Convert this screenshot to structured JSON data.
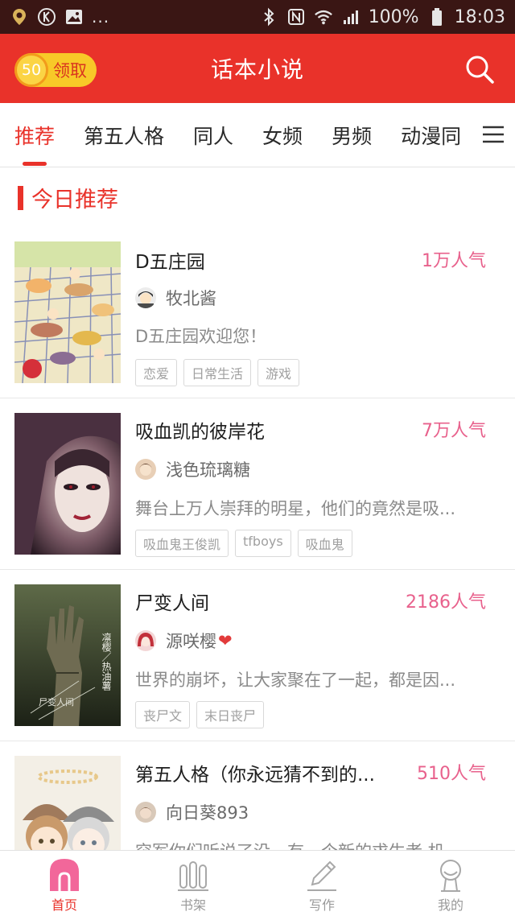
{
  "status_bar": {
    "battery": "100%",
    "time": "18:03",
    "left_icons": [
      "location-pin-icon",
      "k-icon",
      "image-icon"
    ],
    "more": "..."
  },
  "header": {
    "coin_value": "50",
    "coin_label": "领取",
    "title": "话本小说",
    "search_icon": "search-icon",
    "bg_color": "#e9322a"
  },
  "tabs": [
    {
      "label": "推荐",
      "active": true
    },
    {
      "label": "第五人格",
      "active": false
    },
    {
      "label": "同人",
      "active": false
    },
    {
      "label": "女频",
      "active": false
    },
    {
      "label": "男频",
      "active": false
    },
    {
      "label": "动漫同",
      "active": false
    }
  ],
  "section": {
    "title": "今日推荐"
  },
  "books": [
    {
      "title": "D五庄园",
      "popularity": "1万人气",
      "author": "牧北酱",
      "description": "D五庄园欢迎您！",
      "tags": [
        "恋爱",
        "日常生活",
        "游戏"
      ]
    },
    {
      "title": "吸血凯的彼岸花",
      "popularity": "7万人气",
      "author": "浅色琉璃糖",
      "description": "舞台上万人崇拜的明星，他们的竟然是吸...",
      "tags": [
        "吸血鬼王俊凯",
        "tfboys",
        "吸血鬼"
      ]
    },
    {
      "title": "尸变人间",
      "popularity": "2186人气",
      "author": "源咲樱",
      "author_suffix": "❤",
      "description": "世界的崩坏，让大家聚在了一起，都是因...",
      "tags": [
        "丧尸文",
        "末日丧尸"
      ],
      "cover_text": "凛樱／热油薯",
      "cover_title": "尸变人间"
    },
    {
      "title": "第五人格（你永远猜不到的...",
      "popularity": "510人气",
      "author": "向日葵893",
      "description": "突军你们听说了没，有一个新的求生者 机...",
      "tags": []
    }
  ],
  "bottom_nav": [
    {
      "label": "首页",
      "icon": "home-icon",
      "active": true
    },
    {
      "label": "书架",
      "icon": "bookshelf-icon",
      "active": false
    },
    {
      "label": "写作",
      "icon": "pen-icon",
      "active": false
    },
    {
      "label": "我的",
      "icon": "profile-icon",
      "active": false
    }
  ],
  "colors": {
    "accent": "#e9322a",
    "popularity": "#e8618c",
    "coin": "#f8c928"
  }
}
